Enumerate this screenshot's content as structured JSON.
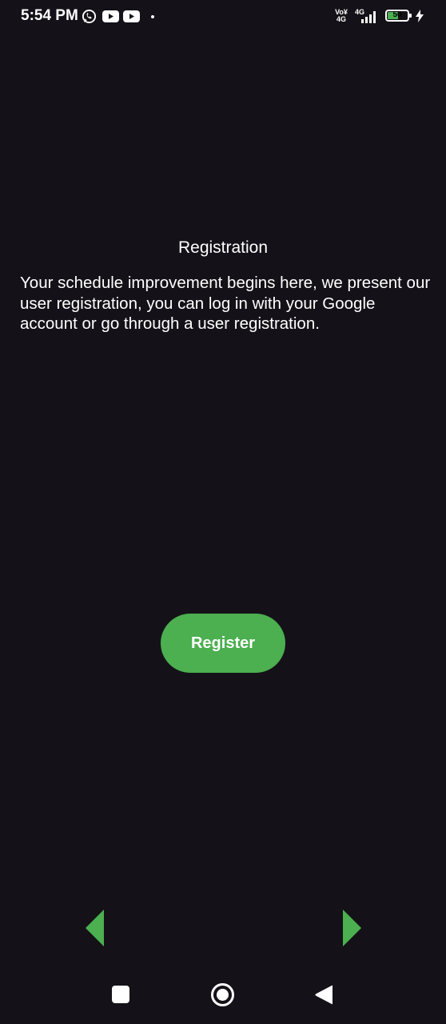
{
  "status_bar": {
    "time": "5:54 PM",
    "network_volte": "Vo¥",
    "network_volte_sub": "4G",
    "network_type": "4G",
    "battery_level": "50",
    "battery_percent": 50,
    "icons": [
      "whatsapp-icon",
      "youtube-icon",
      "youtube-icon",
      "dot-icon",
      "signal-icon",
      "battery-icon",
      "charging-icon"
    ]
  },
  "page": {
    "title": "Registration",
    "description": "Your schedule improvement begins here, we present our user registration, you can log in with your Google account or go through a user registration.",
    "register_button": "Register"
  },
  "pager": {
    "prev_icon": "triangle-left-icon",
    "next_icon": "triangle-right-icon"
  },
  "system_nav": {
    "icons": [
      "recents-square-icon",
      "home-circle-icon",
      "back-triangle-icon"
    ]
  },
  "colors": {
    "background": "#141218",
    "accent": "#4caf50",
    "text": "#ffffff"
  }
}
